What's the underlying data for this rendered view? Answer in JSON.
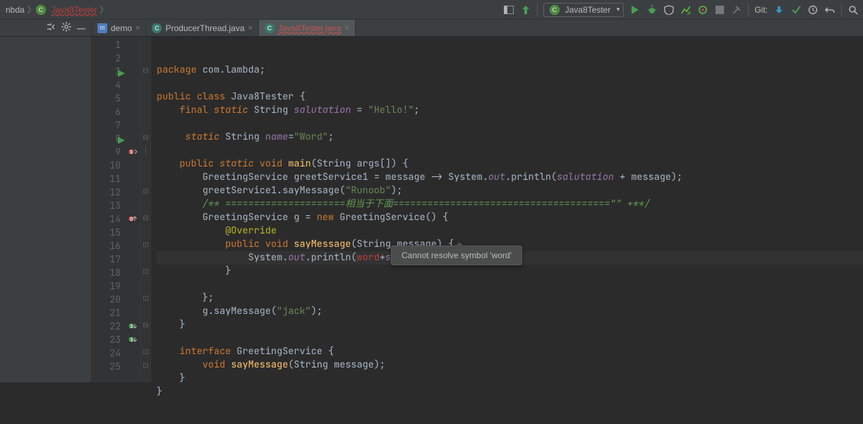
{
  "breadcrumb": {
    "items": [
      "nbda",
      "Java8Tester"
    ]
  },
  "run_config": {
    "label": "Java8Tester"
  },
  "git": {
    "label": "Git:"
  },
  "tabs": [
    {
      "name": "demo",
      "icon": "m"
    },
    {
      "name": "ProducerThread.java",
      "icon": "c"
    },
    {
      "name": "Java8Tester.java",
      "icon": "c",
      "active": true,
      "error": true
    }
  ],
  "gutter": {
    "lines": 25,
    "markers": {
      "3": {
        "run": true
      },
      "8": {
        "run": true
      },
      "9": {
        "override_impl": true
      },
      "14": {
        "override_up": true
      },
      "22": {
        "impl_green_down": true
      },
      "23": {
        "impl_green_down": true
      }
    }
  },
  "fold": {
    "3": "⊟",
    "8": "⊟",
    "9": "┆",
    "12": "⊟",
    "14": "⊟",
    "16": "⊡",
    "18": "⊡",
    "20": "⊡",
    "22": "⊟",
    "24": "⊡",
    "25": "⊡"
  },
  "code": {
    "lines": [
      {
        "n": 1,
        "t": [
          [
            "kw",
            "package "
          ],
          [
            "plain",
            "com.lambda"
          ],
          [
            "op",
            ";"
          ]
        ]
      },
      {
        "n": 2,
        "t": []
      },
      {
        "n": 3,
        "t": [
          [
            "kw",
            "public class "
          ],
          [
            "typeId",
            "Java8Tester "
          ],
          [
            "op",
            "{"
          ]
        ]
      },
      {
        "n": 4,
        "t": [
          [
            "plain",
            "    "
          ],
          [
            "kw",
            "final "
          ],
          [
            "static-kw",
            "static "
          ],
          [
            "typeId",
            "String "
          ],
          [
            "field",
            "salutation"
          ],
          [
            "op",
            " = "
          ],
          [
            "str",
            "\"Hello!\""
          ],
          [
            "op",
            ";"
          ]
        ]
      },
      {
        "n": 5,
        "t": []
      },
      {
        "n": 6,
        "t": [
          [
            "plain",
            "     "
          ],
          [
            "static-kw",
            "static "
          ],
          [
            "typeId",
            "String "
          ],
          [
            "field",
            "name"
          ],
          [
            "op",
            "="
          ],
          [
            "str",
            "\"Word\""
          ],
          [
            "op",
            ";"
          ]
        ]
      },
      {
        "n": 7,
        "t": []
      },
      {
        "n": 8,
        "t": [
          [
            "plain",
            "    "
          ],
          [
            "kw",
            "public "
          ],
          [
            "static-kw",
            "static "
          ],
          [
            "kw",
            "void "
          ],
          [
            "fn",
            "main"
          ],
          [
            "op",
            "("
          ],
          [
            "typeId",
            "String args"
          ],
          [
            "op",
            "[]) {"
          ]
        ]
      },
      {
        "n": 9,
        "t": [
          [
            "plain",
            "        "
          ],
          [
            "typeId",
            "GreetingService greetService1 "
          ],
          [
            "op",
            "= message -> System."
          ],
          [
            "field",
            "out"
          ],
          [
            "op",
            ".println("
          ],
          [
            "field",
            "salutation"
          ],
          [
            "op",
            " + message);"
          ]
        ]
      },
      {
        "n": 10,
        "t": [
          [
            "plain",
            "        "
          ],
          [
            "plain",
            "greetService1.sayMessage("
          ],
          [
            "str",
            "\"Runoob\""
          ],
          [
            "op",
            ");"
          ]
        ]
      },
      {
        "n": 11,
        "t": [
          [
            "plain",
            "        "
          ],
          [
            "comm-green",
            "/** ====================="
          ],
          [
            "comm-green",
            "相当于下面"
          ],
          [
            "comm-green",
            "======================================\"\" +**/"
          ]
        ]
      },
      {
        "n": 12,
        "t": [
          [
            "plain",
            "        "
          ],
          [
            "typeId",
            "GreetingService g "
          ],
          [
            "op",
            "= "
          ],
          [
            "kw",
            "new "
          ],
          [
            "typeId",
            "GreetingService"
          ],
          [
            "op",
            "() {"
          ]
        ]
      },
      {
        "n": 13,
        "t": [
          [
            "plain",
            "            "
          ],
          [
            "ann",
            "@Override"
          ]
        ]
      },
      {
        "n": 14,
        "t": [
          [
            "plain",
            "            "
          ],
          [
            "kw",
            "public void "
          ],
          [
            "fn",
            "sayMessage"
          ],
          [
            "op",
            "("
          ],
          [
            "typeId",
            "String message"
          ],
          [
            "op",
            ") {"
          ]
        ]
      },
      {
        "n": 15,
        "hl": true,
        "t": [
          [
            "plain",
            "                System."
          ],
          [
            "field",
            "out"
          ],
          [
            "op",
            ".println("
          ],
          [
            "err-ident",
            "word"
          ],
          [
            "op",
            "+"
          ],
          [
            "field",
            "salutation"
          ],
          [
            "op",
            " + message);"
          ]
        ]
      },
      {
        "n": 16,
        "t": [
          [
            "plain",
            "            }"
          ]
        ]
      },
      {
        "n": 17,
        "t": []
      },
      {
        "n": 18,
        "t": [
          [
            "plain",
            "        };"
          ]
        ]
      },
      {
        "n": 19,
        "t": [
          [
            "plain",
            "        g.sayMessage("
          ],
          [
            "str",
            "\"jack\""
          ],
          [
            "op",
            ");"
          ]
        ]
      },
      {
        "n": 20,
        "t": [
          [
            "plain",
            "    }"
          ]
        ]
      },
      {
        "n": 21,
        "t": []
      },
      {
        "n": 22,
        "t": [
          [
            "plain",
            "    "
          ],
          [
            "kw",
            "interface "
          ],
          [
            "typeId",
            "GreetingService "
          ],
          [
            "op",
            "{"
          ]
        ]
      },
      {
        "n": 23,
        "t": [
          [
            "plain",
            "        "
          ],
          [
            "kw",
            "void "
          ],
          [
            "fn",
            "sayMessage"
          ],
          [
            "op",
            "("
          ],
          [
            "typeId",
            "String message"
          ],
          [
            "op",
            ");"
          ]
        ]
      },
      {
        "n": 24,
        "t": [
          [
            "plain",
            "    }"
          ]
        ]
      },
      {
        "n": 25,
        "t": [
          [
            "plain",
            "}"
          ]
        ]
      }
    ]
  },
  "tooltip": {
    "text": "Cannot resolve symbol 'word'"
  }
}
